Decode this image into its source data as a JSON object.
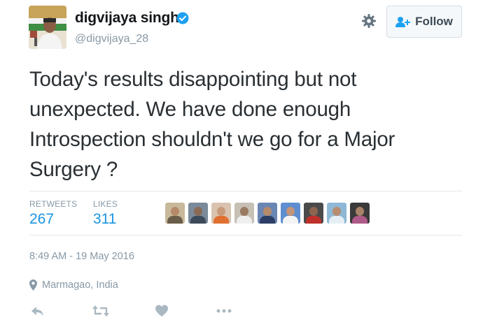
{
  "author": {
    "display_name": "digvijaya singh",
    "handle": "@digvijaya_28",
    "verified": true
  },
  "follow_button": {
    "label": "Follow"
  },
  "tweet": {
    "lines": [
      "Today's results disappointing but not",
      "unexpected. We have done enough",
      "Introspection shouldn't we go for a Major",
      "Surgery ?"
    ]
  },
  "stats": {
    "retweets_label": "RETWEETS",
    "retweets_count": "267",
    "likes_label": "LIKES",
    "likes_count": "311"
  },
  "likers": [
    {
      "skin": "#b58a6a",
      "bg": "#c9b99b",
      "shirt": "#6a5d4a"
    },
    {
      "skin": "#8a6a55",
      "bg": "#7a8a9a",
      "shirt": "#3d4a5a"
    },
    {
      "skin": "#c79a7a",
      "bg": "#d9c3b0",
      "shirt": "#e07030"
    },
    {
      "skin": "#9a7a62",
      "bg": "#c6c0b5",
      "shirt": "#efefef"
    },
    {
      "skin": "#b68b6b",
      "bg": "#6a86b2",
      "shirt": "#2c3e66"
    },
    {
      "skin": "#c39579",
      "bg": "#5f8ed0",
      "shirt": "#f4f4f4"
    },
    {
      "skin": "#8d654f",
      "bg": "#4a4a4a",
      "shirt": "#c0302a"
    },
    {
      "skin": "#b88c70",
      "bg": "#8fb8d6",
      "shirt": "#e6eef5"
    },
    {
      "skin": "#a9826a",
      "bg": "#3a3a3a",
      "shirt": "#b05a8a"
    }
  ],
  "timestamp": "8:49 AM - 19 May 2016",
  "location": "Marmagao, India",
  "icons": {
    "reply": "reply-icon",
    "retweet": "retweet-icon",
    "like": "heart-icon",
    "more": "more-icon",
    "settings": "gear-icon",
    "follow": "follow-person-icon",
    "verified": "verified-badge-icon",
    "location": "location-pin-icon"
  },
  "colors": {
    "link_blue": "#1b95e0",
    "muted_gray": "#8899a6",
    "text": "#292f33",
    "action_gray": "#aab8c2"
  }
}
